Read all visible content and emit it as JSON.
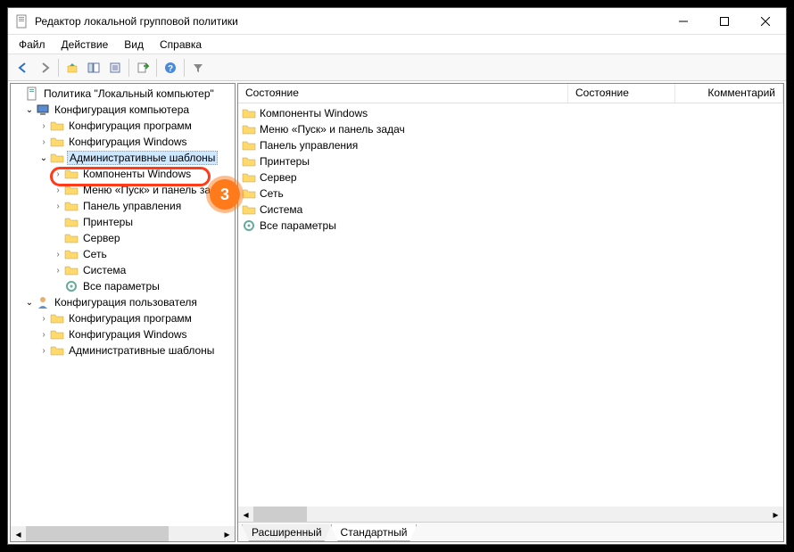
{
  "window": {
    "title": "Редактор локальной групповой политики"
  },
  "menu": {
    "file": "Файл",
    "action": "Действие",
    "view": "Вид",
    "help": "Справка"
  },
  "tree": {
    "root": "Политика \"Локальный компьютер\"",
    "comp_cfg": "Конфигурация компьютера",
    "soft_cfg": "Конфигурация программ",
    "win_cfg": "Конфигурация Windows",
    "admin_tpl": "Административные шаблоны",
    "win_comp": "Компоненты Windows",
    "start_taskbar": "Меню «Пуск» и панель задач",
    "control_panel": "Панель управления",
    "printers": "Принтеры",
    "server": "Сервер",
    "network": "Сеть",
    "system": "Система",
    "all_params": "Все параметры",
    "user_cfg": "Конфигурация пользователя"
  },
  "list": {
    "col_state": "Состояние",
    "col_state2": "Состояние",
    "col_comment": "Комментарий",
    "items": [
      "Компоненты Windows",
      "Меню «Пуск» и панель задач",
      "Панель управления",
      "Принтеры",
      "Сервер",
      "Сеть",
      "Система",
      "Все параметры"
    ]
  },
  "tabs": {
    "extended": "Расширенный",
    "standard": "Стандартный"
  },
  "annotation": {
    "badge": "3"
  }
}
